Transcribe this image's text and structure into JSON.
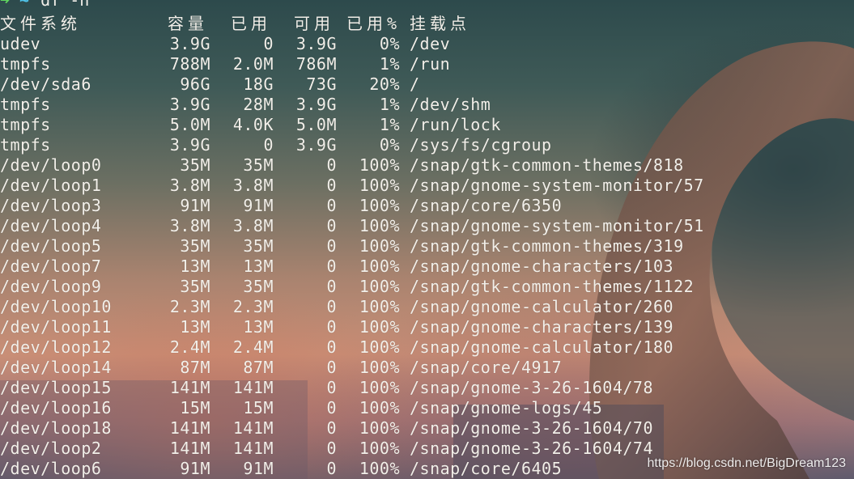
{
  "prompt": {
    "arrow": "➜",
    "dir": "~",
    "command": "df -h"
  },
  "header": {
    "filesystem": "文件系统",
    "size": "容量",
    "used": "已用",
    "avail": "可用",
    "use_pct": "已用%",
    "mount": "挂载点"
  },
  "rows": [
    {
      "fs": "udev",
      "size": "3.9G",
      "used": "0",
      "avail": "3.9G",
      "pct": "0%",
      "mount": "/dev"
    },
    {
      "fs": "tmpfs",
      "size": "788M",
      "used": "2.0M",
      "avail": "786M",
      "pct": "1%",
      "mount": "/run"
    },
    {
      "fs": "/dev/sda6",
      "size": "96G",
      "used": "18G",
      "avail": "73G",
      "pct": "20%",
      "mount": "/"
    },
    {
      "fs": "tmpfs",
      "size": "3.9G",
      "used": "28M",
      "avail": "3.9G",
      "pct": "1%",
      "mount": "/dev/shm"
    },
    {
      "fs": "tmpfs",
      "size": "5.0M",
      "used": "4.0K",
      "avail": "5.0M",
      "pct": "1%",
      "mount": "/run/lock"
    },
    {
      "fs": "tmpfs",
      "size": "3.9G",
      "used": "0",
      "avail": "3.9G",
      "pct": "0%",
      "mount": "/sys/fs/cgroup"
    },
    {
      "fs": "/dev/loop0",
      "size": "35M",
      "used": "35M",
      "avail": "0",
      "pct": "100%",
      "mount": "/snap/gtk-common-themes/818"
    },
    {
      "fs": "/dev/loop1",
      "size": "3.8M",
      "used": "3.8M",
      "avail": "0",
      "pct": "100%",
      "mount": "/snap/gnome-system-monitor/57"
    },
    {
      "fs": "/dev/loop3",
      "size": "91M",
      "used": "91M",
      "avail": "0",
      "pct": "100%",
      "mount": "/snap/core/6350"
    },
    {
      "fs": "/dev/loop4",
      "size": "3.8M",
      "used": "3.8M",
      "avail": "0",
      "pct": "100%",
      "mount": "/snap/gnome-system-monitor/51"
    },
    {
      "fs": "/dev/loop5",
      "size": "35M",
      "used": "35M",
      "avail": "0",
      "pct": "100%",
      "mount": "/snap/gtk-common-themes/319"
    },
    {
      "fs": "/dev/loop7",
      "size": "13M",
      "used": "13M",
      "avail": "0",
      "pct": "100%",
      "mount": "/snap/gnome-characters/103"
    },
    {
      "fs": "/dev/loop9",
      "size": "35M",
      "used": "35M",
      "avail": "0",
      "pct": "100%",
      "mount": "/snap/gtk-common-themes/1122"
    },
    {
      "fs": "/dev/loop10",
      "size": "2.3M",
      "used": "2.3M",
      "avail": "0",
      "pct": "100%",
      "mount": "/snap/gnome-calculator/260"
    },
    {
      "fs": "/dev/loop11",
      "size": "13M",
      "used": "13M",
      "avail": "0",
      "pct": "100%",
      "mount": "/snap/gnome-characters/139"
    },
    {
      "fs": "/dev/loop12",
      "size": "2.4M",
      "used": "2.4M",
      "avail": "0",
      "pct": "100%",
      "mount": "/snap/gnome-calculator/180"
    },
    {
      "fs": "/dev/loop14",
      "size": "87M",
      "used": "87M",
      "avail": "0",
      "pct": "100%",
      "mount": "/snap/core/4917"
    },
    {
      "fs": "/dev/loop15",
      "size": "141M",
      "used": "141M",
      "avail": "0",
      "pct": "100%",
      "mount": "/snap/gnome-3-26-1604/78"
    },
    {
      "fs": "/dev/loop16",
      "size": "15M",
      "used": "15M",
      "avail": "0",
      "pct": "100%",
      "mount": "/snap/gnome-logs/45"
    },
    {
      "fs": "/dev/loop18",
      "size": "141M",
      "used": "141M",
      "avail": "0",
      "pct": "100%",
      "mount": "/snap/gnome-3-26-1604/70"
    },
    {
      "fs": "/dev/loop2",
      "size": "141M",
      "used": "141M",
      "avail": "0",
      "pct": "100%",
      "mount": "/snap/gnome-3-26-1604/74"
    },
    {
      "fs": "/dev/loop6",
      "size": "91M",
      "used": "91M",
      "avail": "0",
      "pct": "100%",
      "mount": "/snap/core/6405"
    }
  ],
  "watermark": "https://blog.csdn.net/BigDream123"
}
